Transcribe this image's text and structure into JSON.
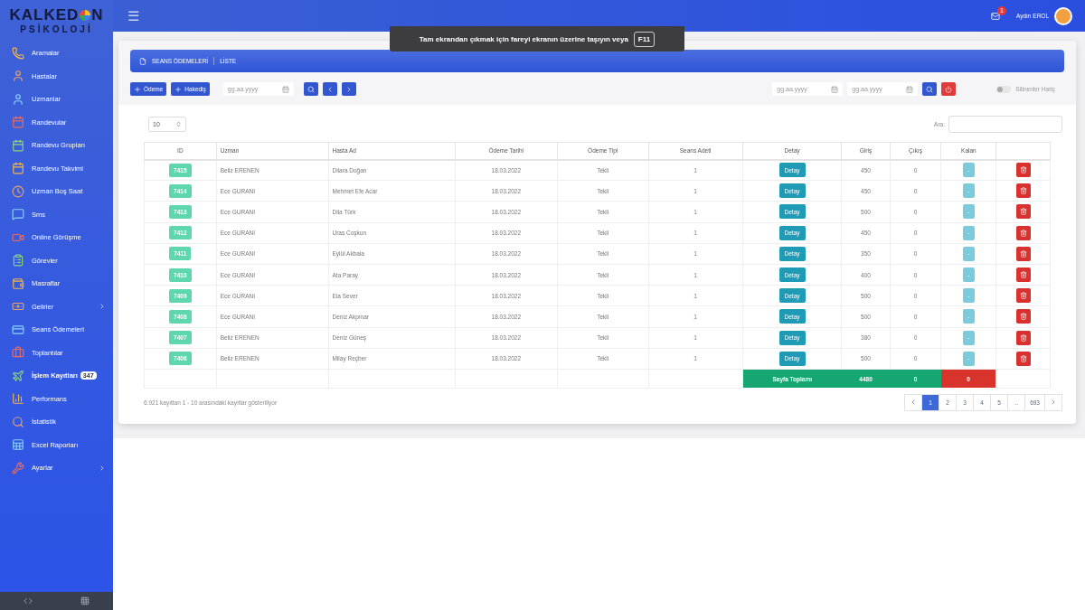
{
  "logo": {
    "left": "KALKED",
    "right": "N",
    "subtitle": "PSİKOLOJİ"
  },
  "sidebar": {
    "items": [
      {
        "label": "Aramalar",
        "arrow": false
      },
      {
        "label": "Hastalar",
        "arrow": false
      },
      {
        "label": "Uzmanlar",
        "arrow": false
      },
      {
        "label": "Randevular",
        "arrow": false
      },
      {
        "label": "Randevu Grupları",
        "arrow": false
      },
      {
        "label": "Randevu Takvimi",
        "arrow": false
      },
      {
        "label": "Uzman Boş Saat",
        "arrow": false
      },
      {
        "label": "Sms",
        "arrow": false
      },
      {
        "label": "Online Görüşme",
        "arrow": false
      },
      {
        "label": "Görevler",
        "arrow": false
      },
      {
        "label": "Masraflar",
        "arrow": false
      },
      {
        "label": "Gelirler",
        "arrow": true
      },
      {
        "label": "Seans Ödemeleri",
        "arrow": false
      },
      {
        "label": "Toplantılar",
        "arrow": false
      },
      {
        "label": "İşlem Kayıtları",
        "arrow": false,
        "bold": true,
        "badge": "347"
      },
      {
        "label": "Performans",
        "arrow": false
      },
      {
        "label": "İstatistik",
        "arrow": false
      },
      {
        "label": "Excel Raporları",
        "arrow": false
      },
      {
        "label": "Ayarlar",
        "arrow": true
      }
    ]
  },
  "topbar": {
    "menu": "☰",
    "mail_badge": "1",
    "user": "Aydın EROL"
  },
  "fullscreen_notice": {
    "text": "Tam ekrandan çıkmak için fareyi ekranın üzerine taşıyın veya",
    "key": "F11"
  },
  "breadcrumb": [
    "SEANS ÖDEMELERİ",
    "LİSTE"
  ],
  "toolbar": {
    "buttons": [
      "Ödeme",
      "Hakediş"
    ],
    "date_placeholder": "gg.aa.yyyy",
    "right_dates": [
      "gg.aa.yyyy",
      "gg.aa.yyyy"
    ],
    "toggle": {
      "label": "Silinenler Hariç",
      "on": false
    }
  },
  "page_size": "10",
  "search_label": "Ara:",
  "table": {
    "columns": [
      "ID",
      "Uzman",
      "Hasta Ad",
      "Ödeme Tarihi",
      "Ödeme Tipi",
      "Seans Adeti",
      "Detay",
      "Giriş",
      "Çıkış",
      "Kalan"
    ],
    "rows": [
      {
        "id": "7415",
        "expert": "Beliz ERENEN",
        "patient": "Dilara Doğan",
        "date": "18.03.2022",
        "type": "Tekli",
        "count": "1",
        "detail": "Detay",
        "in": "450",
        "out": "0",
        "remaining": "-"
      },
      {
        "id": "7414",
        "expert": "Ece GURANI",
        "patient": "Mehmet Efe Acar",
        "date": "18.03.2022",
        "type": "Tekli",
        "count": "1",
        "detail": "Detay",
        "in": "450",
        "out": "0",
        "remaining": "-"
      },
      {
        "id": "7413",
        "expert": "Ece GURANI",
        "patient": "Dila Türk",
        "date": "18.03.2022",
        "type": "Tekli",
        "count": "1",
        "detail": "Detay",
        "in": "500",
        "out": "0",
        "remaining": "-"
      },
      {
        "id": "7412",
        "expert": "Ece GURANI",
        "patient": "Uras Coşkun",
        "date": "18.03.2022",
        "type": "Tekli",
        "count": "1",
        "detail": "Detay",
        "in": "450",
        "out": "0",
        "remaining": "-"
      },
      {
        "id": "7411",
        "expert": "Ece GURANI",
        "patient": "Eylül Akbala",
        "date": "18.03.2022",
        "type": "Tekli",
        "count": "1",
        "detail": "Detay",
        "in": "350",
        "out": "0",
        "remaining": "-"
      },
      {
        "id": "7410",
        "expert": "Ece GURANI",
        "patient": "Ata Paray",
        "date": "18.03.2022",
        "type": "Tekli",
        "count": "1",
        "detail": "Detay",
        "in": "400",
        "out": "0",
        "remaining": "-"
      },
      {
        "id": "7409",
        "expert": "Ece GURANI",
        "patient": "Ela Sever",
        "date": "18.03.2022",
        "type": "Tekli",
        "count": "1",
        "detail": "Detay",
        "in": "500",
        "out": "0",
        "remaining": "-"
      },
      {
        "id": "7408",
        "expert": "Ece GURANI",
        "patient": "Deniz Akpınar",
        "date": "18.03.2022",
        "type": "Tekli",
        "count": "1",
        "detail": "Detay",
        "in": "500",
        "out": "0",
        "remaining": "-"
      },
      {
        "id": "7407",
        "expert": "Beliz ERENEN",
        "patient": "Deniz Güneş",
        "date": "18.03.2022",
        "type": "Tekli",
        "count": "1",
        "detail": "Detay",
        "in": "380",
        "out": "0",
        "remaining": "-"
      },
      {
        "id": "7406",
        "expert": "Beliz ERENEN",
        "patient": "Milay Reçber",
        "date": "18.03.2022",
        "type": "Tekli",
        "count": "1",
        "detail": "Detay",
        "in": "500",
        "out": "0",
        "remaining": "-"
      }
    ],
    "totals": {
      "label": "Sayfa Toplamı",
      "in": "4480",
      "out": "0",
      "remaining": "0"
    }
  },
  "info": "6.921 kayıttan 1 - 10 arasındaki kayıtlar gösteriliyor",
  "pagination": [
    {
      "label": "1",
      "selected": true
    },
    {
      "label": "2",
      "selected": false
    },
    {
      "label": "3",
      "selected": false
    },
    {
      "label": "4",
      "selected": false
    },
    {
      "label": "5",
      "selected": false
    },
    {
      "label": "..",
      "selected": false
    },
    {
      "label": "693",
      "selected": false
    }
  ]
}
